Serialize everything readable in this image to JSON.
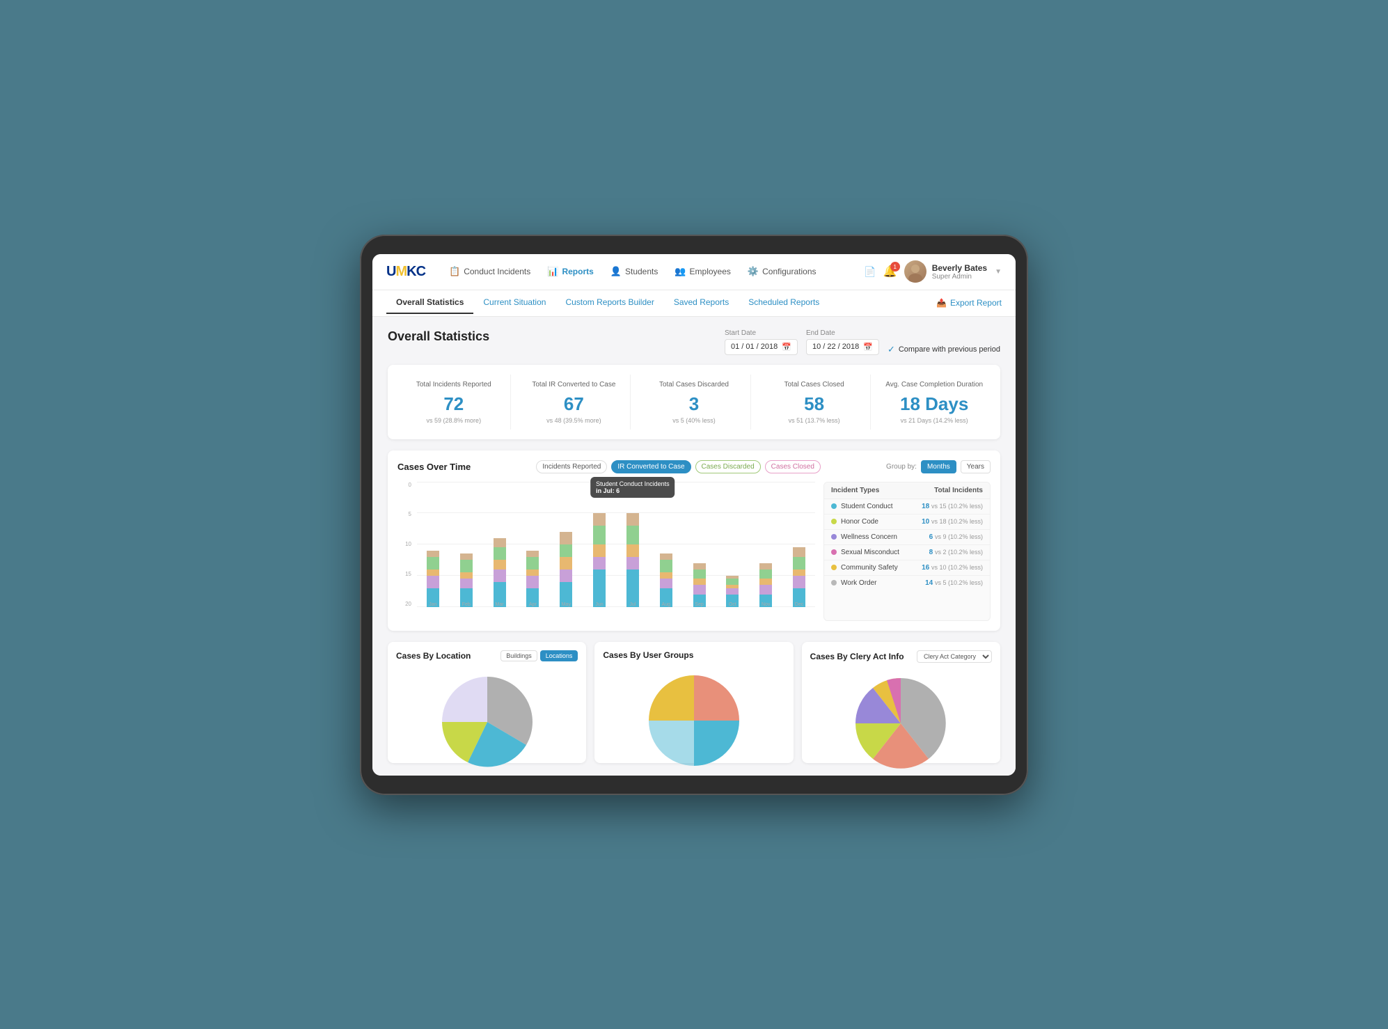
{
  "app": {
    "logo": "UMKC",
    "logo_highlight": "M"
  },
  "nav": {
    "items": [
      {
        "id": "conduct",
        "label": "Conduct Incidents",
        "icon": "📋",
        "active": false
      },
      {
        "id": "reports",
        "label": "Reports",
        "icon": "📊",
        "active": true
      },
      {
        "id": "students",
        "label": "Students",
        "icon": "👤",
        "active": false
      },
      {
        "id": "employees",
        "label": "Employees",
        "icon": "👥",
        "active": false
      },
      {
        "id": "configurations",
        "label": "Configurations",
        "icon": "⚙️",
        "active": false
      }
    ],
    "notification_count": "1",
    "user_name": "Beverly Bates",
    "user_role": "Super Admin"
  },
  "sub_nav": {
    "items": [
      {
        "id": "overall",
        "label": "Overall Statistics",
        "active": true
      },
      {
        "id": "current",
        "label": "Current Situation",
        "active": false
      },
      {
        "id": "custom",
        "label": "Custom Reports Builder",
        "active": false
      },
      {
        "id": "saved",
        "label": "Saved Reports",
        "active": false
      },
      {
        "id": "scheduled",
        "label": "Scheduled Reports",
        "active": false
      }
    ],
    "export_label": "Export Report"
  },
  "page": {
    "title": "Overall Statistics",
    "start_date_label": "Start Date",
    "start_date": "01 / 01 / 2018",
    "end_date_label": "End Date",
    "end_date": "10 / 22 / 2018",
    "compare_label": "Compare with previous period"
  },
  "stats": [
    {
      "label": "Total Incidents Reported",
      "value": "72",
      "compare": "vs 59 (28.8% more)"
    },
    {
      "label": "Total IR Converted to Case",
      "value": "67",
      "compare": "vs 48 (39.5% more)"
    },
    {
      "label": "Total Cases Discarded",
      "value": "3",
      "compare": "vs 5 (40% less)"
    },
    {
      "label": "Total Cases Closed",
      "value": "58",
      "compare": "vs 51 (13.7% less)"
    },
    {
      "label": "Avg. Case Completion Duration",
      "value": "18 Days",
      "compare": "vs 21 Days (14.2% less)"
    }
  ],
  "chart": {
    "title": "Cases Over Time",
    "filters": [
      {
        "id": "incidents",
        "label": "Incidents Reported",
        "active": false
      },
      {
        "id": "converted",
        "label": "IR Converted to Case",
        "active": true
      },
      {
        "id": "discarded",
        "label": "Cases Discarded",
        "active": false
      },
      {
        "id": "closed",
        "label": "Cases Closed",
        "active": false
      }
    ],
    "group_by": {
      "label": "Group by:",
      "options": [
        {
          "id": "months",
          "label": "Months",
          "active": true
        },
        {
          "id": "years",
          "label": "Years",
          "active": false
        }
      ]
    },
    "y_axis": [
      "0",
      "5",
      "10",
      "15",
      "20"
    ],
    "tooltip": {
      "text": "Student Conduct Incidents",
      "sub": "in Jul: 6"
    },
    "months": [
      "Jan",
      "Feb",
      "Mar",
      "Apr",
      "May",
      "Jun",
      "Jul",
      "Aug",
      "Sep",
      "Oct",
      "Nov",
      "Dec"
    ],
    "bars": [
      {
        "month": "Jan",
        "segments": [
          3,
          2,
          1,
          2,
          1
        ]
      },
      {
        "month": "Feb",
        "segments": [
          3,
          1.5,
          1,
          2,
          1
        ]
      },
      {
        "month": "Mar",
        "segments": [
          4,
          2,
          1.5,
          2,
          1.5
        ]
      },
      {
        "month": "Apr",
        "segments": [
          3,
          2,
          1,
          2,
          1
        ]
      },
      {
        "month": "May",
        "segments": [
          4,
          2,
          2,
          2,
          2
        ]
      },
      {
        "month": "Jun",
        "segments": [
          6,
          2,
          2,
          3,
          2
        ]
      },
      {
        "month": "Jul",
        "segments": [
          6,
          2,
          2,
          3,
          2
        ]
      },
      {
        "month": "Aug",
        "segments": [
          3,
          1.5,
          1,
          2,
          1
        ]
      },
      {
        "month": "Sep",
        "segments": [
          2,
          1.5,
          1,
          1.5,
          1
        ]
      },
      {
        "month": "Oct",
        "segments": [
          2,
          1,
          0.5,
          1,
          0.5
        ]
      },
      {
        "month": "Nov",
        "segments": [
          2,
          1.5,
          1,
          1.5,
          1
        ]
      },
      {
        "month": "Dec",
        "segments": [
          3,
          2,
          1,
          2,
          1.5
        ]
      }
    ],
    "bar_colors": [
      "#4db8d4",
      "#c8a0d8",
      "#e8b870",
      "#90d090",
      "#d4b490"
    ]
  },
  "incident_types": {
    "header_type": "Incident Types",
    "header_total": "Total Incidents",
    "rows": [
      {
        "color": "#4db8d4",
        "name": "Student Conduct",
        "count": "18",
        "vs": "vs 15 (10.2% less)"
      },
      {
        "color": "#c8d848",
        "name": "Honor Code",
        "count": "10",
        "vs": "vs 18 (10.2% less)"
      },
      {
        "color": "#9888d8",
        "name": "Wellness Concern",
        "count": "6",
        "vs": "vs 9 (10.2% less)"
      },
      {
        "color": "#d870b0",
        "name": "Sexual Misconduct",
        "count": "8",
        "vs": "vs 2 (10.2% less)"
      },
      {
        "color": "#e8c040",
        "name": "Community Safety",
        "count": "16",
        "vs": "vs 10 (10.2% less)"
      },
      {
        "color": "#b8b8b8",
        "name": "Work Order",
        "count": "14",
        "vs": "vs 5 (10.2% less)"
      }
    ]
  },
  "bottom": {
    "location_title": "Cases By Location",
    "location_filters": [
      "Buildings",
      "Locations"
    ],
    "location_active": "Locations",
    "usergroups_title": "Cases By User Groups",
    "clery_title": "Cases By Clery Act Info",
    "clery_select": "Clery Act Category"
  }
}
